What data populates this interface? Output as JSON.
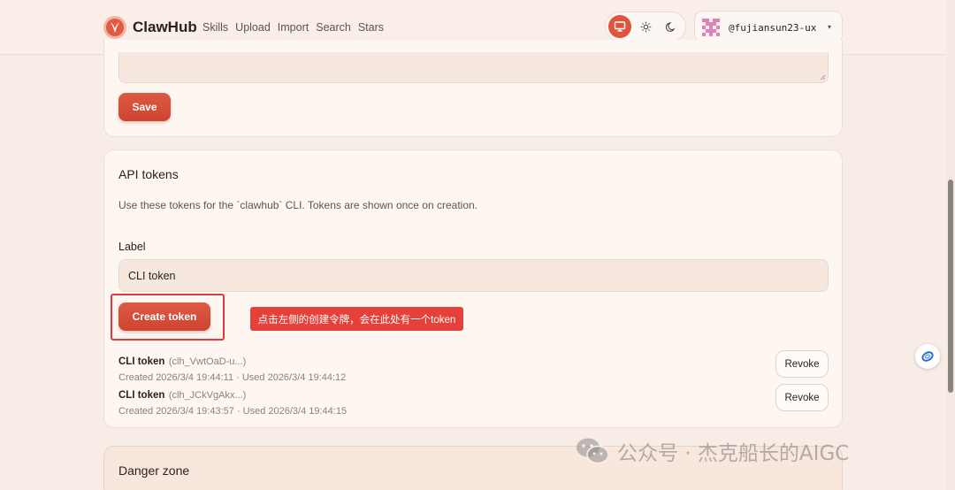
{
  "header": {
    "brand": "ClawHub",
    "nav": [
      "Skills",
      "Upload",
      "Import",
      "Search",
      "Stars"
    ],
    "theme_icons": [
      "monitor-icon",
      "sun-icon",
      "moon-icon"
    ],
    "active_theme": "system",
    "user_handle": "@fujiansun23-ux",
    "menu_caret": "▾"
  },
  "profile_card": {
    "save_label": "Save"
  },
  "api_tokens": {
    "title": "API tokens",
    "description": "Use these tokens for the `clawhub` CLI. Tokens are shown once on creation.",
    "label": "Label",
    "input_value": "CLI token",
    "create_label": "Create token",
    "annotation": "点击左侧的创建令牌，会在此处有一个token",
    "tokens": [
      {
        "name": "CLI token",
        "prefix": "(clh_VwtOaD-u...)",
        "meta": "Created 2026/3/4 19:44:11 · Used 2026/3/4 19:44:12",
        "revoke_label": "Revoke"
      },
      {
        "name": "CLI token",
        "prefix": "(clh_JCkVgAkx...)",
        "meta": "Created 2026/3/4 19:43:57 · Used 2026/3/4 19:44:15",
        "revoke_label": "Revoke"
      }
    ]
  },
  "danger_zone": {
    "title": "Danger zone"
  },
  "watermark": {
    "text": "公众号 · 杰克船长的AIGC"
  },
  "colors": {
    "accent": "#de5a43",
    "background": "#f8ede6",
    "card": "#fdf6f1",
    "annotation_red": "#e6403a"
  }
}
